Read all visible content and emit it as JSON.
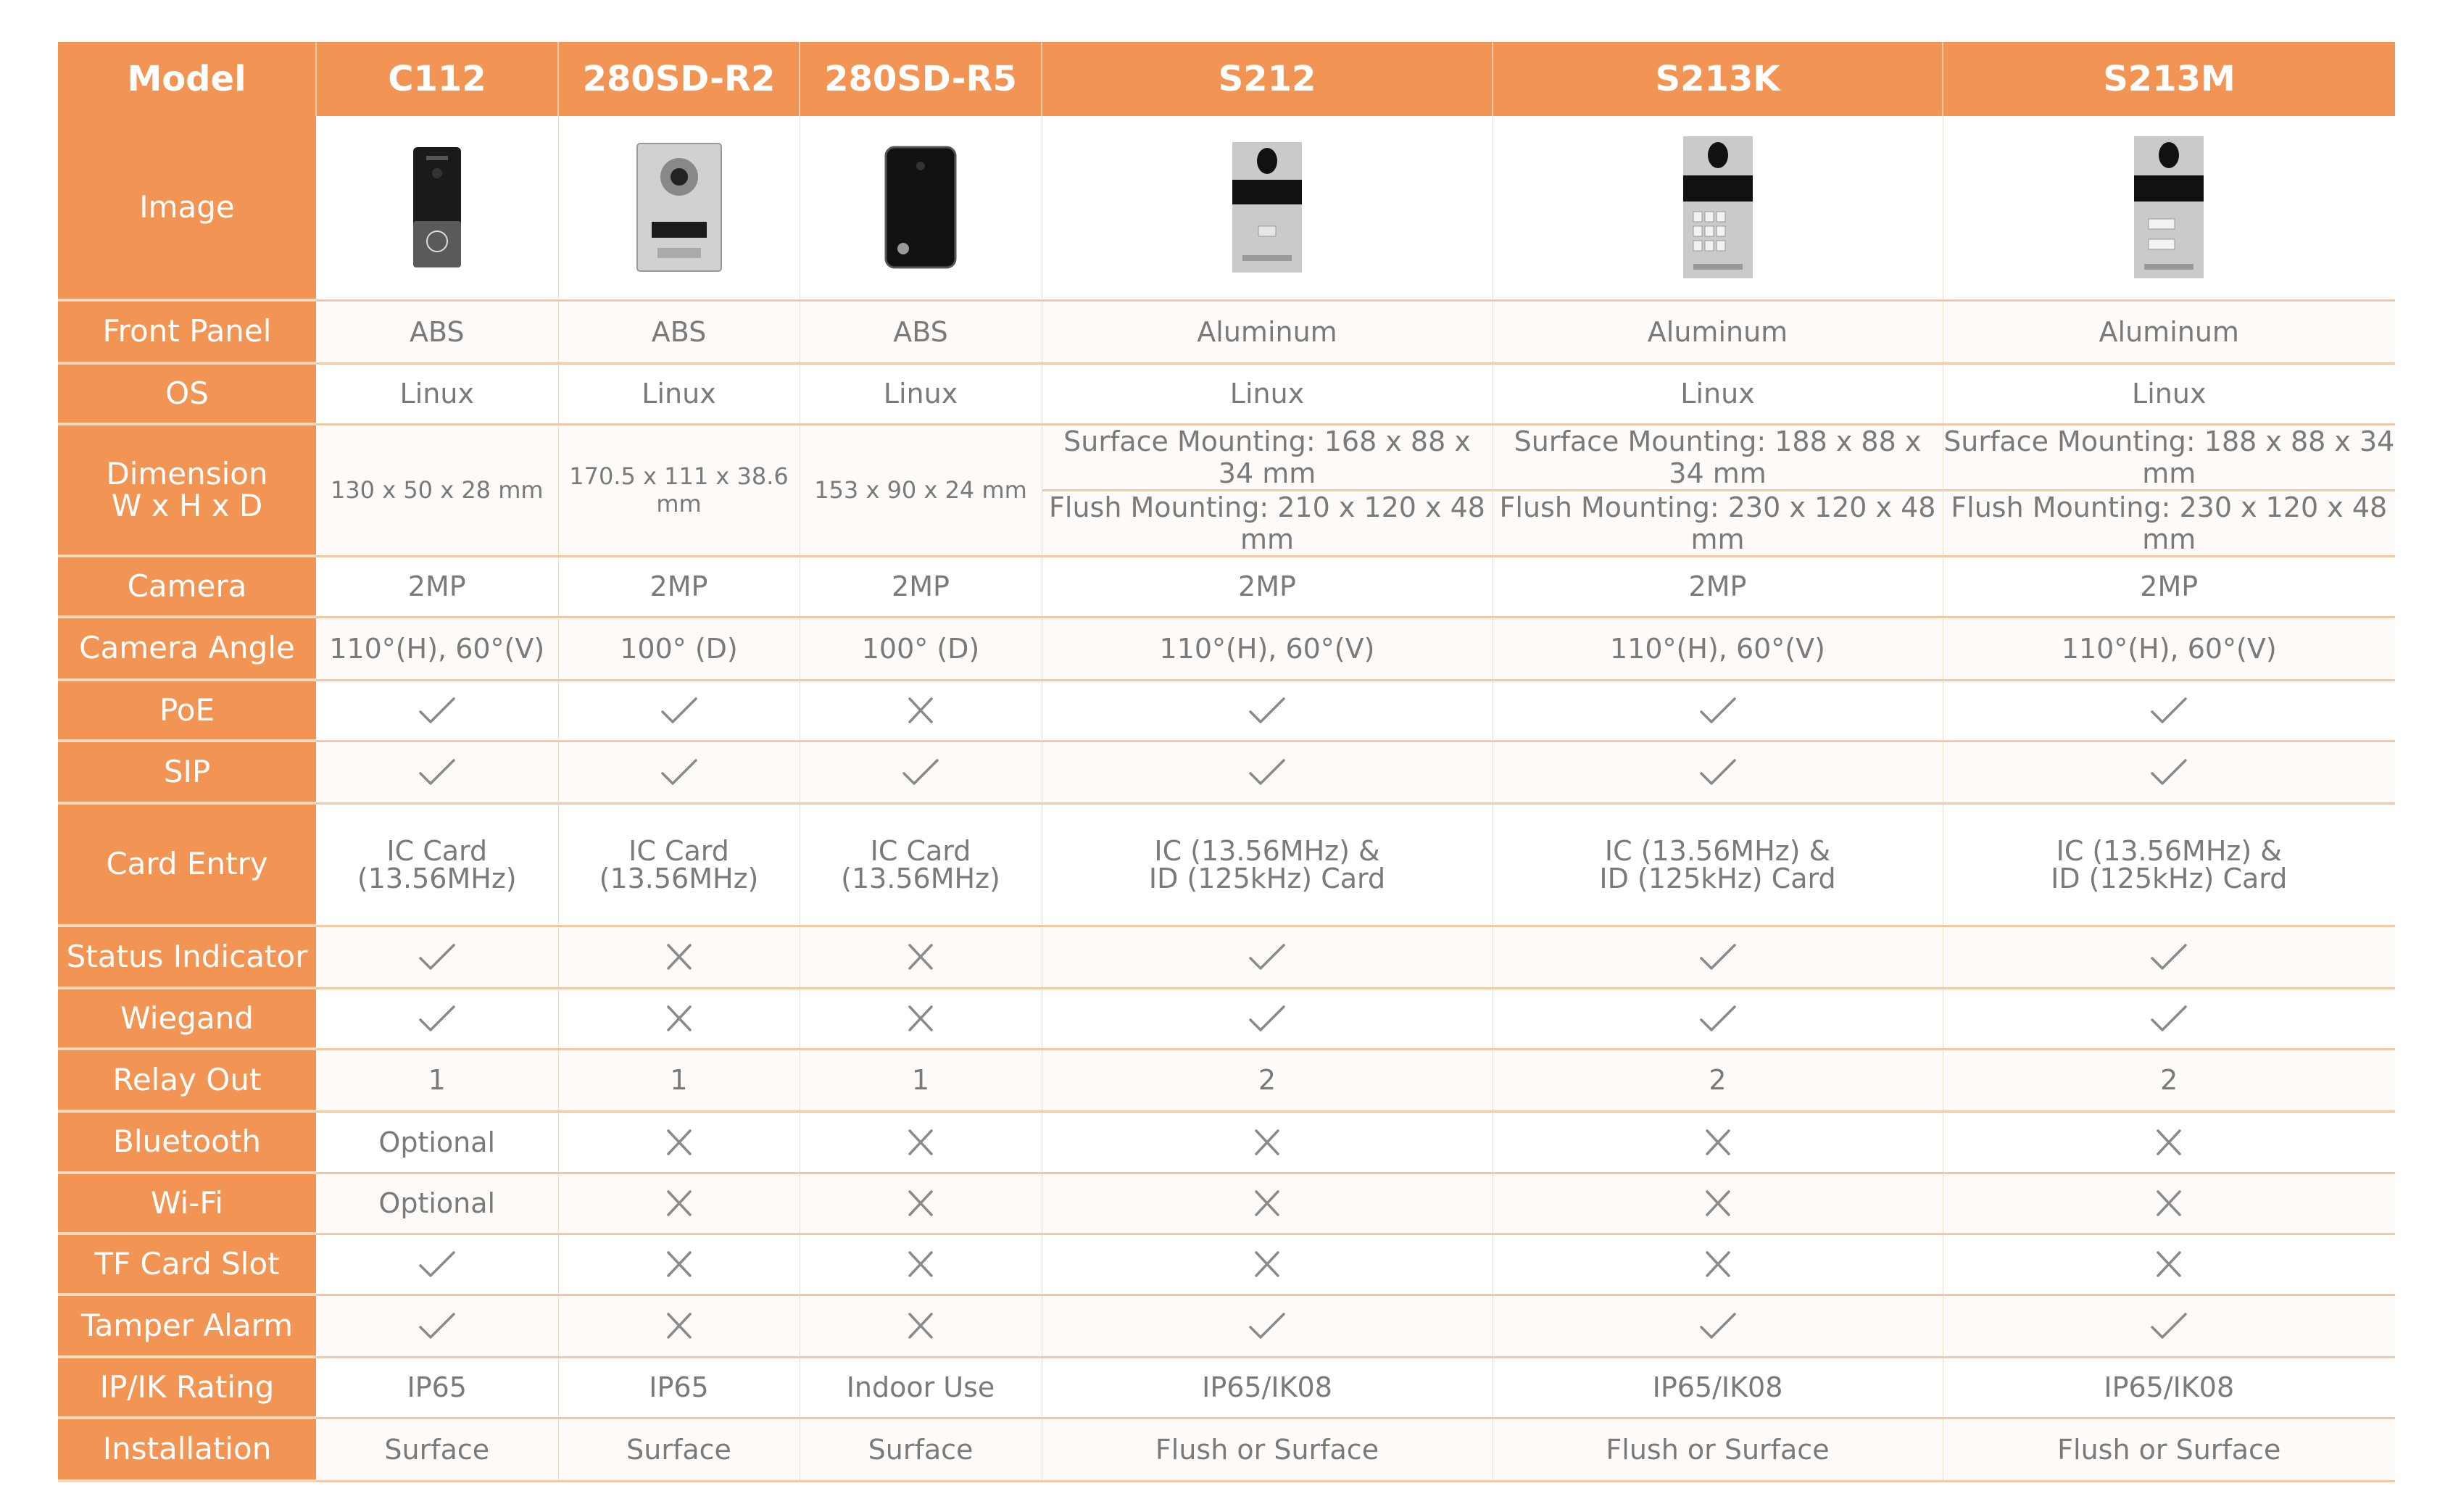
{
  "colors": {
    "header_bg": "#f19454",
    "label_text": "#ffffff",
    "cell_text": "#7a7a7a",
    "row_alt_bg": "#fdfaf7",
    "border": "#f3c8a4"
  },
  "header": {
    "label": "Model",
    "models": [
      "C112",
      "280SD-R2",
      "280SD-R5",
      "S212",
      "S213K",
      "S213M"
    ]
  },
  "rows": [
    {
      "label": "Image",
      "type": "image",
      "values": [
        "c112-device-image",
        "280sd-r2-device-image",
        "280sd-r5-device-image",
        "s212-device-image",
        "s213k-device-image",
        "s213m-device-image"
      ]
    },
    {
      "label": "Front Panel",
      "type": "text",
      "values": [
        "ABS",
        "ABS",
        "ABS",
        "Aluminum",
        "Aluminum",
        "Aluminum"
      ]
    },
    {
      "label": "OS",
      "type": "text",
      "values": [
        "Linux",
        "Linux",
        "Linux",
        "Linux",
        "Linux",
        "Linux"
      ]
    },
    {
      "label_lines": [
        "Dimension",
        "W x H x D"
      ],
      "type": "dimension",
      "values": [
        {
          "single": "130 x 50 x 28 mm"
        },
        {
          "single": "170.5 x 111 x 38.6 mm"
        },
        {
          "single": "153 x 90 x 24 mm"
        },
        {
          "surface": "Surface Mounting: 168 x 88 x 34 mm",
          "flush": "Flush Mounting: 210 x 120 x 48 mm"
        },
        {
          "surface": "Surface Mounting: 188 x 88 x 34 mm",
          "flush": "Flush Mounting: 230 x 120 x 48 mm"
        },
        {
          "surface": "Surface Mounting: 188 x 88 x 34 mm",
          "flush": "Flush Mounting: 230 x 120 x 48 mm"
        }
      ]
    },
    {
      "label": "Camera",
      "type": "text",
      "values": [
        "2MP",
        "2MP",
        "2MP",
        "2MP",
        "2MP",
        "2MP"
      ]
    },
    {
      "label": "Camera Angle",
      "type": "text",
      "values": [
        "110°(H), 60°(V)",
        "100° (D)",
        "100° (D)",
        "110°(H), 60°(V)",
        "110°(H), 60°(V)",
        "110°(H), 60°(V)"
      ]
    },
    {
      "label": "PoE",
      "type": "mark",
      "values": [
        "check",
        "check",
        "cross",
        "check",
        "check",
        "check"
      ]
    },
    {
      "label": "SIP",
      "type": "mark",
      "values": [
        "check",
        "check",
        "check",
        "check",
        "check",
        "check"
      ]
    },
    {
      "label": "Card Entry",
      "type": "twoline",
      "values": [
        [
          "IC Card",
          "(13.56MHz)"
        ],
        [
          "IC Card",
          "(13.56MHz)"
        ],
        [
          "IC Card",
          "(13.56MHz)"
        ],
        [
          "IC (13.56MHz) &",
          "ID (125kHz) Card"
        ],
        [
          "IC (13.56MHz) &",
          "ID (125kHz) Card"
        ],
        [
          "IC (13.56MHz) &",
          "ID (125kHz) Card"
        ]
      ]
    },
    {
      "label": "Status Indicator",
      "type": "mark",
      "values": [
        "check",
        "cross",
        "cross",
        "check",
        "check",
        "check"
      ]
    },
    {
      "label": "Wiegand",
      "type": "mark",
      "values": [
        "check",
        "cross",
        "cross",
        "check",
        "check",
        "check"
      ]
    },
    {
      "label": "Relay Out",
      "type": "text",
      "values": [
        "1",
        "1",
        "1",
        "2",
        "2",
        "2"
      ]
    },
    {
      "label": "Bluetooth",
      "type": "mixed",
      "values": [
        "Optional",
        "cross",
        "cross",
        "cross",
        "cross",
        "cross"
      ]
    },
    {
      "label": "Wi-Fi",
      "type": "mixed",
      "values": [
        "Optional",
        "cross",
        "cross",
        "cross",
        "cross",
        "cross"
      ]
    },
    {
      "label": "TF Card Slot",
      "type": "mark",
      "values": [
        "check",
        "cross",
        "cross",
        "cross",
        "cross",
        "cross"
      ]
    },
    {
      "label": "Tamper Alarm",
      "type": "mark",
      "values": [
        "check",
        "cross",
        "cross",
        "check",
        "check",
        "check"
      ]
    },
    {
      "label": "IP/IK Rating",
      "type": "text",
      "values": [
        "IP65",
        "IP65",
        "Indoor Use",
        "IP65/IK08",
        "IP65/IK08",
        "IP65/IK08"
      ]
    },
    {
      "label": "Installation",
      "type": "text",
      "values": [
        "Surface",
        "Surface",
        "Surface",
        "Flush or Surface",
        "Flush or Surface",
        "Flush or Surface"
      ]
    }
  ]
}
